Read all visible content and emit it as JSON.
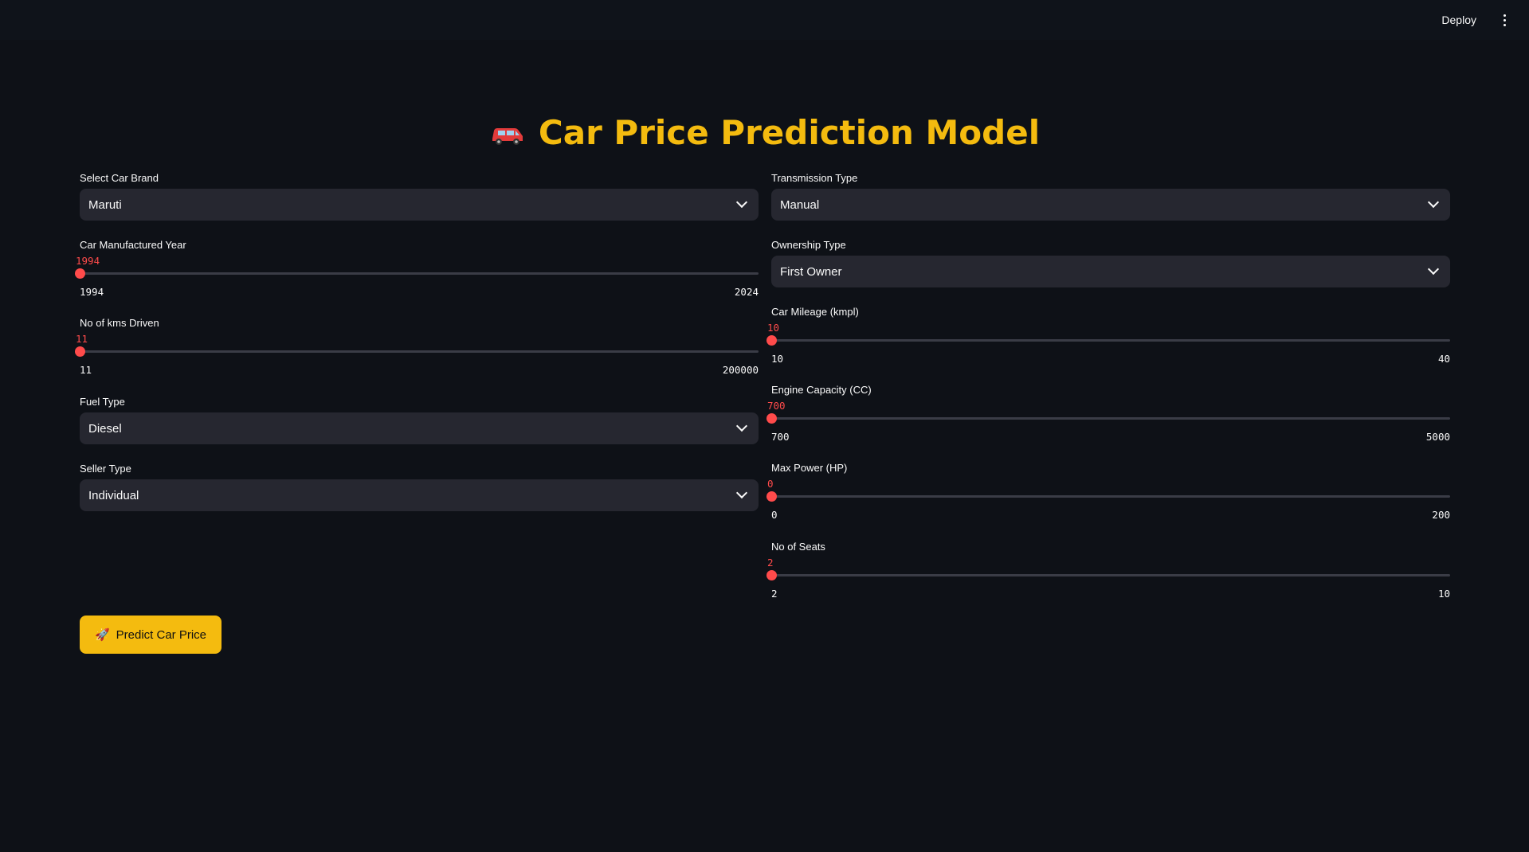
{
  "header": {
    "deploy_label": "Deploy",
    "menu_icon": "more-vert-icon"
  },
  "title": "Car Price Prediction Model",
  "title_icon": "car-icon",
  "accent_color": "#f4bb0f",
  "slider_color": "#ff4b4b",
  "left": {
    "brand": {
      "label": "Select Car Brand",
      "value": "Maruti"
    },
    "year": {
      "label": "Car Manufactured Year",
      "value": "1994",
      "min": "1994",
      "max": "2024",
      "fraction": 0
    },
    "kms": {
      "label": "No of kms Driven",
      "value": "11",
      "min": "11",
      "max": "200000",
      "fraction": 0
    },
    "fuel": {
      "label": "Fuel Type",
      "value": "Diesel"
    },
    "seller": {
      "label": "Seller Type",
      "value": "Individual"
    }
  },
  "right": {
    "transmission": {
      "label": "Transmission Type",
      "value": "Manual"
    },
    "ownership": {
      "label": "Ownership Type",
      "value": "First Owner"
    },
    "mileage": {
      "label": "Car Mileage (kmpl)",
      "value": "10",
      "min": "10",
      "max": "40",
      "fraction": 0
    },
    "engine": {
      "label": "Engine Capacity (CC)",
      "value": "700",
      "min": "700",
      "max": "5000",
      "fraction": 0
    },
    "power": {
      "label": "Max Power (HP)",
      "value": "0",
      "min": "0",
      "max": "200",
      "fraction": 0
    },
    "seats": {
      "label": "No of Seats",
      "value": "2",
      "min": "2",
      "max": "10",
      "fraction": 0
    }
  },
  "predict_button": {
    "label": "Predict Car Price",
    "icon": "rocket-icon"
  }
}
